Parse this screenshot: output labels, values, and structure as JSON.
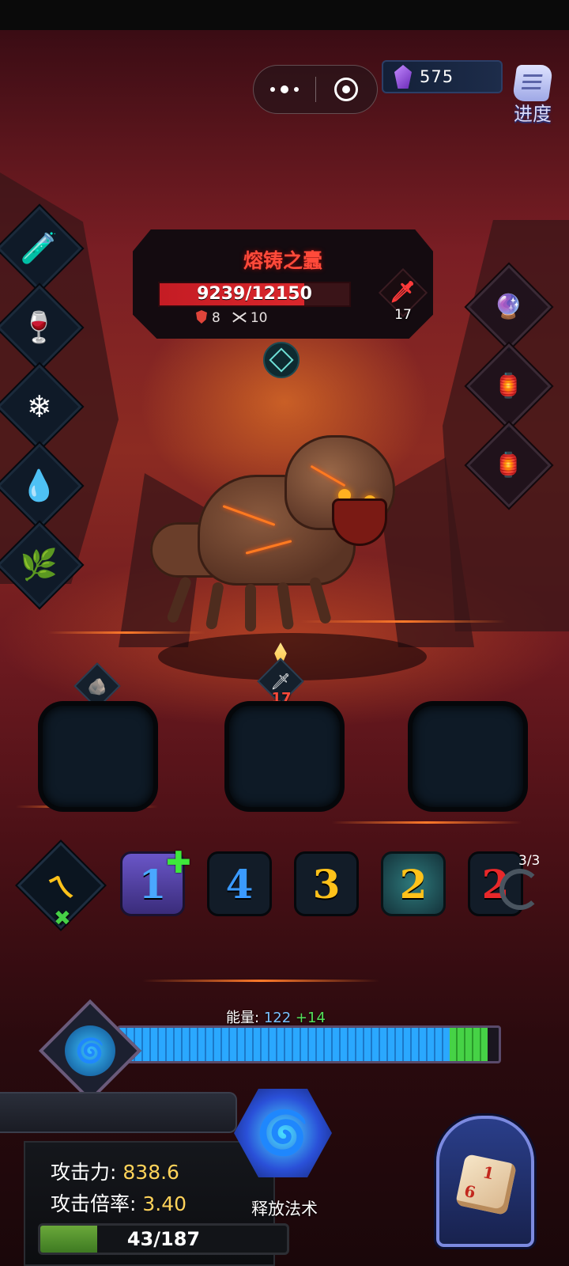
{
  "hud": {
    "gems": "575",
    "progress_label": "进度"
  },
  "boss": {
    "name": "熔铸之蠹",
    "hp_text": "9239/12150",
    "hp_current": 9239,
    "hp_max": 12150,
    "armor": "8",
    "attack_count": "10",
    "intent_value": "17"
  },
  "battlefield": {
    "incoming_damage": "17"
  },
  "left_skills": [
    {
      "name": "mana-potion-icon"
    },
    {
      "name": "red-potion-icon"
    },
    {
      "name": "ice-spirit-icon"
    },
    {
      "name": "water-leaf-icon"
    },
    {
      "name": "herb-pot-icon"
    }
  ],
  "right_slots": [
    {
      "name": "crystal-orb-icon"
    },
    {
      "name": "lantern-icon"
    },
    {
      "name": "lantern-icon"
    }
  ],
  "dice": [
    {
      "value": "1",
      "color": "#4aa8ff"
    },
    {
      "value": "4",
      "color": "#3a9aff"
    },
    {
      "value": "3",
      "color": "#ffc21a"
    },
    {
      "value": "2",
      "color": "#ffc21a"
    },
    {
      "value": "2",
      "color": "#e8282a"
    }
  ],
  "spell_symbol": "ㄟ",
  "reroll": "3/3",
  "energy": {
    "label": "能量:",
    "value": "122",
    "gain": "+14",
    "current": 122,
    "gain_amount": 14,
    "max": 140
  },
  "stats": {
    "attack_label": "攻击力:",
    "attack_value": "838.6",
    "multiplier_label": "攻击倍率:",
    "multiplier_value": "3.40"
  },
  "player_hp": {
    "text": "43/187",
    "current": 43,
    "max": 187
  },
  "cast_label": "释放法术",
  "dice_card": {
    "top": "1",
    "side": "6"
  }
}
